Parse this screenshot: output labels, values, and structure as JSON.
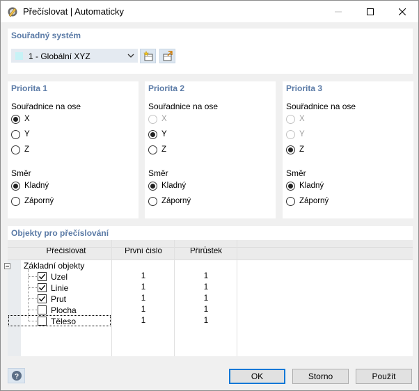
{
  "window": {
    "title": "Přečíslovat | Automaticky",
    "controls": {
      "minimize": "minimize-icon",
      "maximize": "maximize-icon",
      "close": "close-icon"
    }
  },
  "coordinate_system": {
    "title": "Souřadný systém",
    "selected": "1 - Globální XYZ",
    "swatch_color": "#c7f2f6"
  },
  "priorities": [
    {
      "title": "Priorita 1",
      "axis_label": "Souřadnice na ose",
      "axes": [
        {
          "label": "X",
          "checked": true,
          "disabled": false
        },
        {
          "label": "Y",
          "checked": false,
          "disabled": false
        },
        {
          "label": "Z",
          "checked": false,
          "disabled": false
        }
      ],
      "direction_label": "Směr",
      "directions": [
        {
          "label": "Kladný",
          "checked": true
        },
        {
          "label": "Záporný",
          "checked": false
        }
      ]
    },
    {
      "title": "Priorita 2",
      "axis_label": "Souřadnice na ose",
      "axes": [
        {
          "label": "X",
          "checked": false,
          "disabled": true
        },
        {
          "label": "Y",
          "checked": true,
          "disabled": false
        },
        {
          "label": "Z",
          "checked": false,
          "disabled": false
        }
      ],
      "direction_label": "Směr",
      "directions": [
        {
          "label": "Kladný",
          "checked": true
        },
        {
          "label": "Záporný",
          "checked": false
        }
      ]
    },
    {
      "title": "Priorita 3",
      "axis_label": "Souřadnice na ose",
      "axes": [
        {
          "label": "X",
          "checked": false,
          "disabled": true
        },
        {
          "label": "Y",
          "checked": false,
          "disabled": true
        },
        {
          "label": "Z",
          "checked": true,
          "disabled": false
        }
      ],
      "direction_label": "Směr",
      "directions": [
        {
          "label": "Kladný",
          "checked": true
        },
        {
          "label": "Záporný",
          "checked": false
        }
      ]
    }
  ],
  "objects": {
    "title": "Objekty pro přečíslování",
    "columns": [
      "Přečíslovat",
      "První číslo",
      "Přírůstek"
    ],
    "group": "Základní objekty",
    "rows": [
      {
        "name": "Uzel",
        "checked": true,
        "first": "1",
        "increment": "1"
      },
      {
        "name": "Linie",
        "checked": true,
        "first": "1",
        "increment": "1"
      },
      {
        "name": "Prut",
        "checked": true,
        "first": "1",
        "increment": "1"
      },
      {
        "name": "Plocha",
        "checked": false,
        "first": "1",
        "increment": "1"
      },
      {
        "name": "Těleso",
        "checked": false,
        "first": "1",
        "increment": "1"
      }
    ]
  },
  "footer": {
    "ok": "OK",
    "cancel": "Storno",
    "apply": "Použít"
  }
}
